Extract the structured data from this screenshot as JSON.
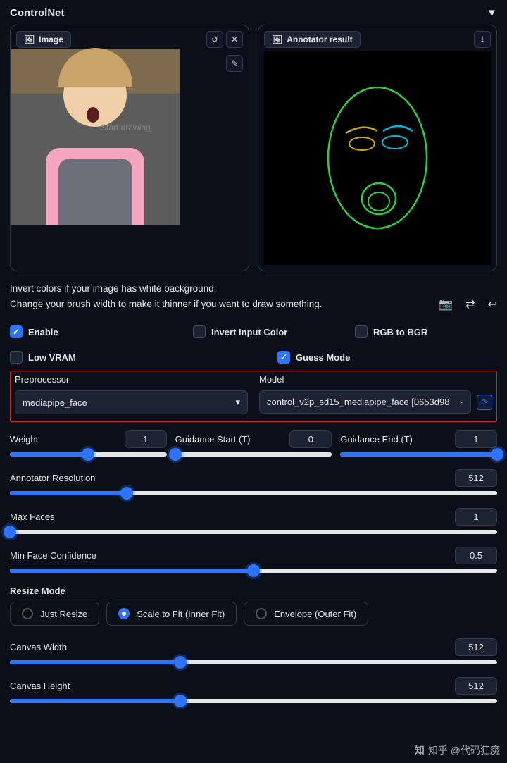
{
  "header": {
    "title": "ControlNet"
  },
  "image_tab": {
    "label": "Image",
    "draw_hint": "Start drawing"
  },
  "annotator_tab": {
    "label": "Annotator result"
  },
  "hints": {
    "line1": "Invert colors if your image has white background.",
    "line2": "Change your brush width to make it thinner if you want to draw something."
  },
  "checks": {
    "enable": "Enable",
    "invert": "Invert Input Color",
    "rgb2bgr": "RGB to BGR",
    "lowvram": "Low VRAM",
    "guess": "Guess Mode"
  },
  "preproc": {
    "label": "Preprocessor",
    "value": "mediapipe_face"
  },
  "model": {
    "label": "Model",
    "value": "control_v2p_sd15_mediapipe_face [0653d98"
  },
  "sliders": {
    "weight": {
      "label": "Weight",
      "value": "1"
    },
    "gstart": {
      "label": "Guidance Start (T)",
      "value": "0"
    },
    "gend": {
      "label": "Guidance End (T)",
      "value": "1"
    },
    "annres": {
      "label": "Annotator Resolution",
      "value": "512"
    },
    "maxfaces": {
      "label": "Max Faces",
      "value": "1"
    },
    "minface": {
      "label": "Min Face Confidence",
      "value": "0.5"
    },
    "cwidth": {
      "label": "Canvas Width",
      "value": "512"
    },
    "cheight": {
      "label": "Canvas Height",
      "value": "512"
    }
  },
  "resize": {
    "label": "Resize Mode",
    "just": "Just Resize",
    "scale": "Scale to Fit (Inner Fit)",
    "env": "Envelope (Outer Fit)"
  },
  "watermark": "知乎 @代码狂魔"
}
